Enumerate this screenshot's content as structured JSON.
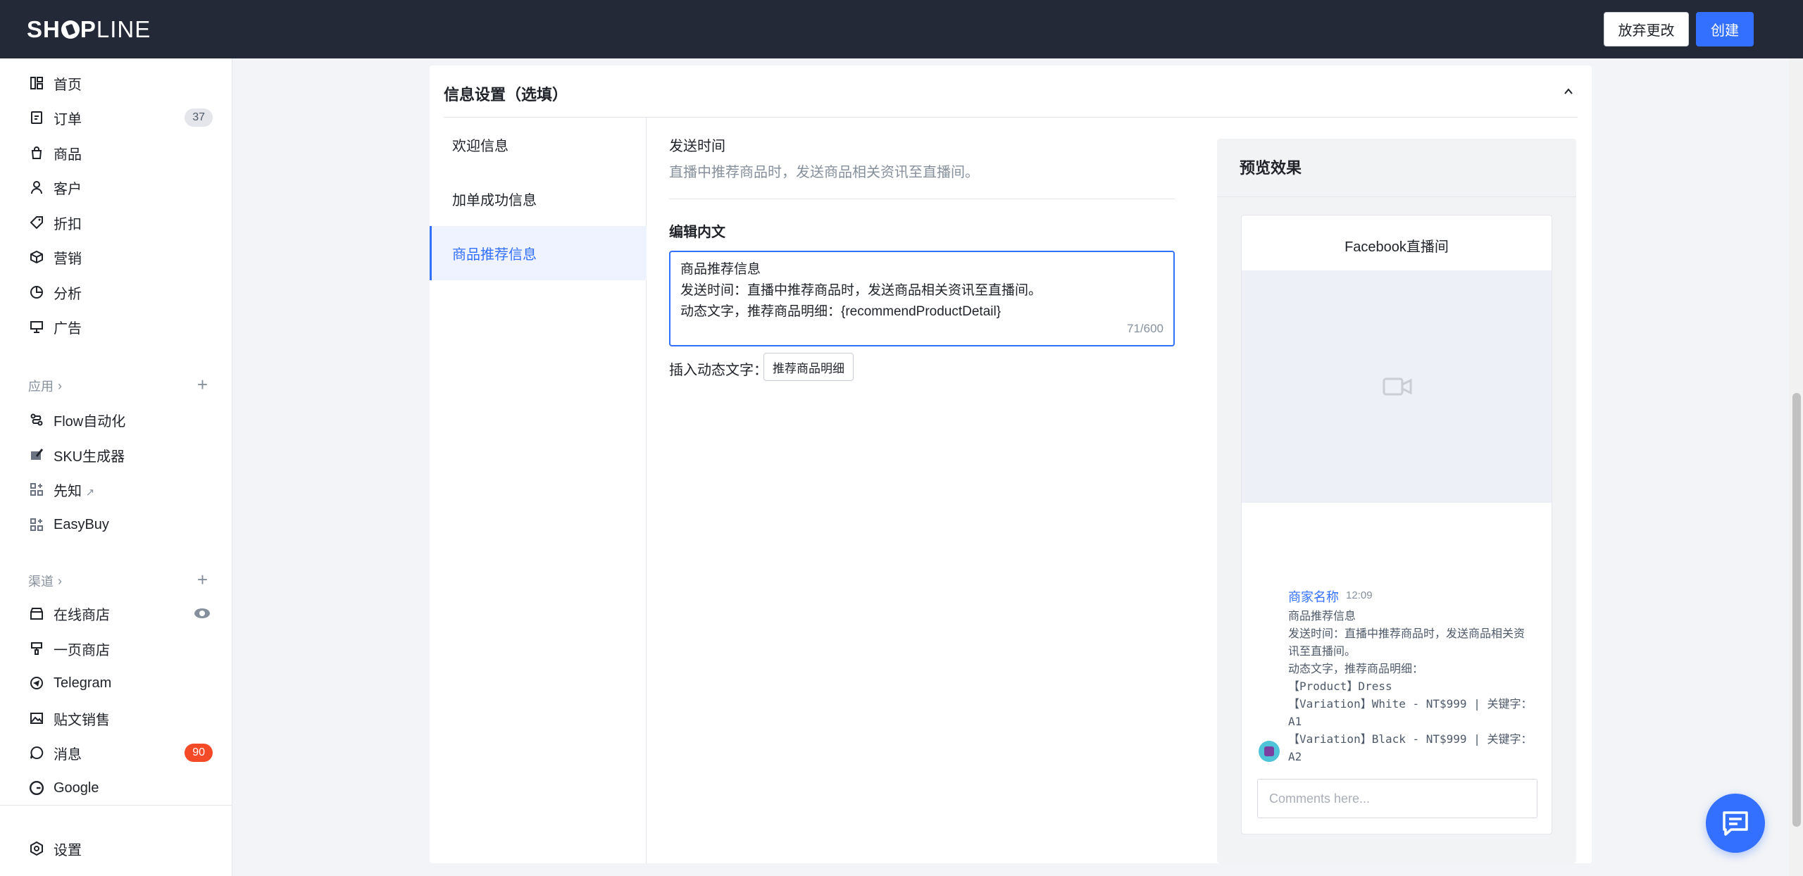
{
  "brand": {
    "logo_text_bold": "SH",
    "logo_text_bold2": "P",
    "logo_text_light": "LINE",
    "accent": "#3370ff"
  },
  "topbar": {
    "discard_label": "放弃更改",
    "create_label": "创建"
  },
  "sidebar": {
    "items": [
      {
        "label": "首页",
        "icon": "dashboard-icon"
      },
      {
        "label": "订单",
        "icon": "order-icon",
        "badge": "37"
      },
      {
        "label": "商品",
        "icon": "bag-icon"
      },
      {
        "label": "客户",
        "icon": "user-icon"
      },
      {
        "label": "折扣",
        "icon": "tag-icon"
      },
      {
        "label": "营销",
        "icon": "box-icon"
      },
      {
        "label": "分析",
        "icon": "pie-icon"
      },
      {
        "label": "广告",
        "icon": "billboard-icon"
      }
    ],
    "apps_header": "应用",
    "apps": [
      {
        "label": "Flow自动化",
        "icon": "flow-icon"
      },
      {
        "label": "SKU生成器",
        "icon": "sku-icon"
      },
      {
        "label": "先知",
        "icon": "apps-icon"
      },
      {
        "label": "EasyBuy",
        "icon": "apps-icon"
      }
    ],
    "channels_header": "渠道",
    "channels": [
      {
        "label": "在线商店",
        "icon": "store-icon"
      },
      {
        "label": "一页商店",
        "icon": "brush-icon"
      },
      {
        "label": "Telegram",
        "icon": "telegram-icon"
      },
      {
        "label": "贴文销售",
        "icon": "image-icon"
      },
      {
        "label": "消息",
        "icon": "chat-icon",
        "badge": "90"
      },
      {
        "label": "Google",
        "icon": "google-icon"
      }
    ],
    "settings_label": "设置"
  },
  "card": {
    "title": "信息设置（选填）",
    "tabs": [
      {
        "label": "欢迎信息"
      },
      {
        "label": "加单成功信息"
      },
      {
        "label": "商品推荐信息",
        "active": true
      }
    ]
  },
  "form": {
    "send_time_label": "发送时间",
    "send_time_desc": "直播中推荐商品时，发送商品相关资讯至直播间。",
    "edit_label": "编辑内文",
    "text_lines": [
      "商品推荐信息",
      "发送时间：直播中推荐商品时，发送商品相关资讯至直播间。",
      "动态文字，推荐商品明细：{recommendProductDetail}"
    ],
    "counter": "71/600",
    "insert_label": "插入动态文字：",
    "insert_button": "推荐商品明细"
  },
  "preview": {
    "title": "预览效果",
    "phone_title": "Facebook直播间",
    "merchant_name": "商家名称",
    "time": "12:09",
    "message": "商品推荐信息\n发送时间：直播中推荐商品时，发送商品相关资讯至直播间。\n动态文字，推荐商品明细：\n【Product】Dress\n【Variation】White - NT$999 | 关键字：A1\n【Variation】Black - NT$999 | 关键字：A2",
    "comment_placeholder": "Comments here..."
  }
}
